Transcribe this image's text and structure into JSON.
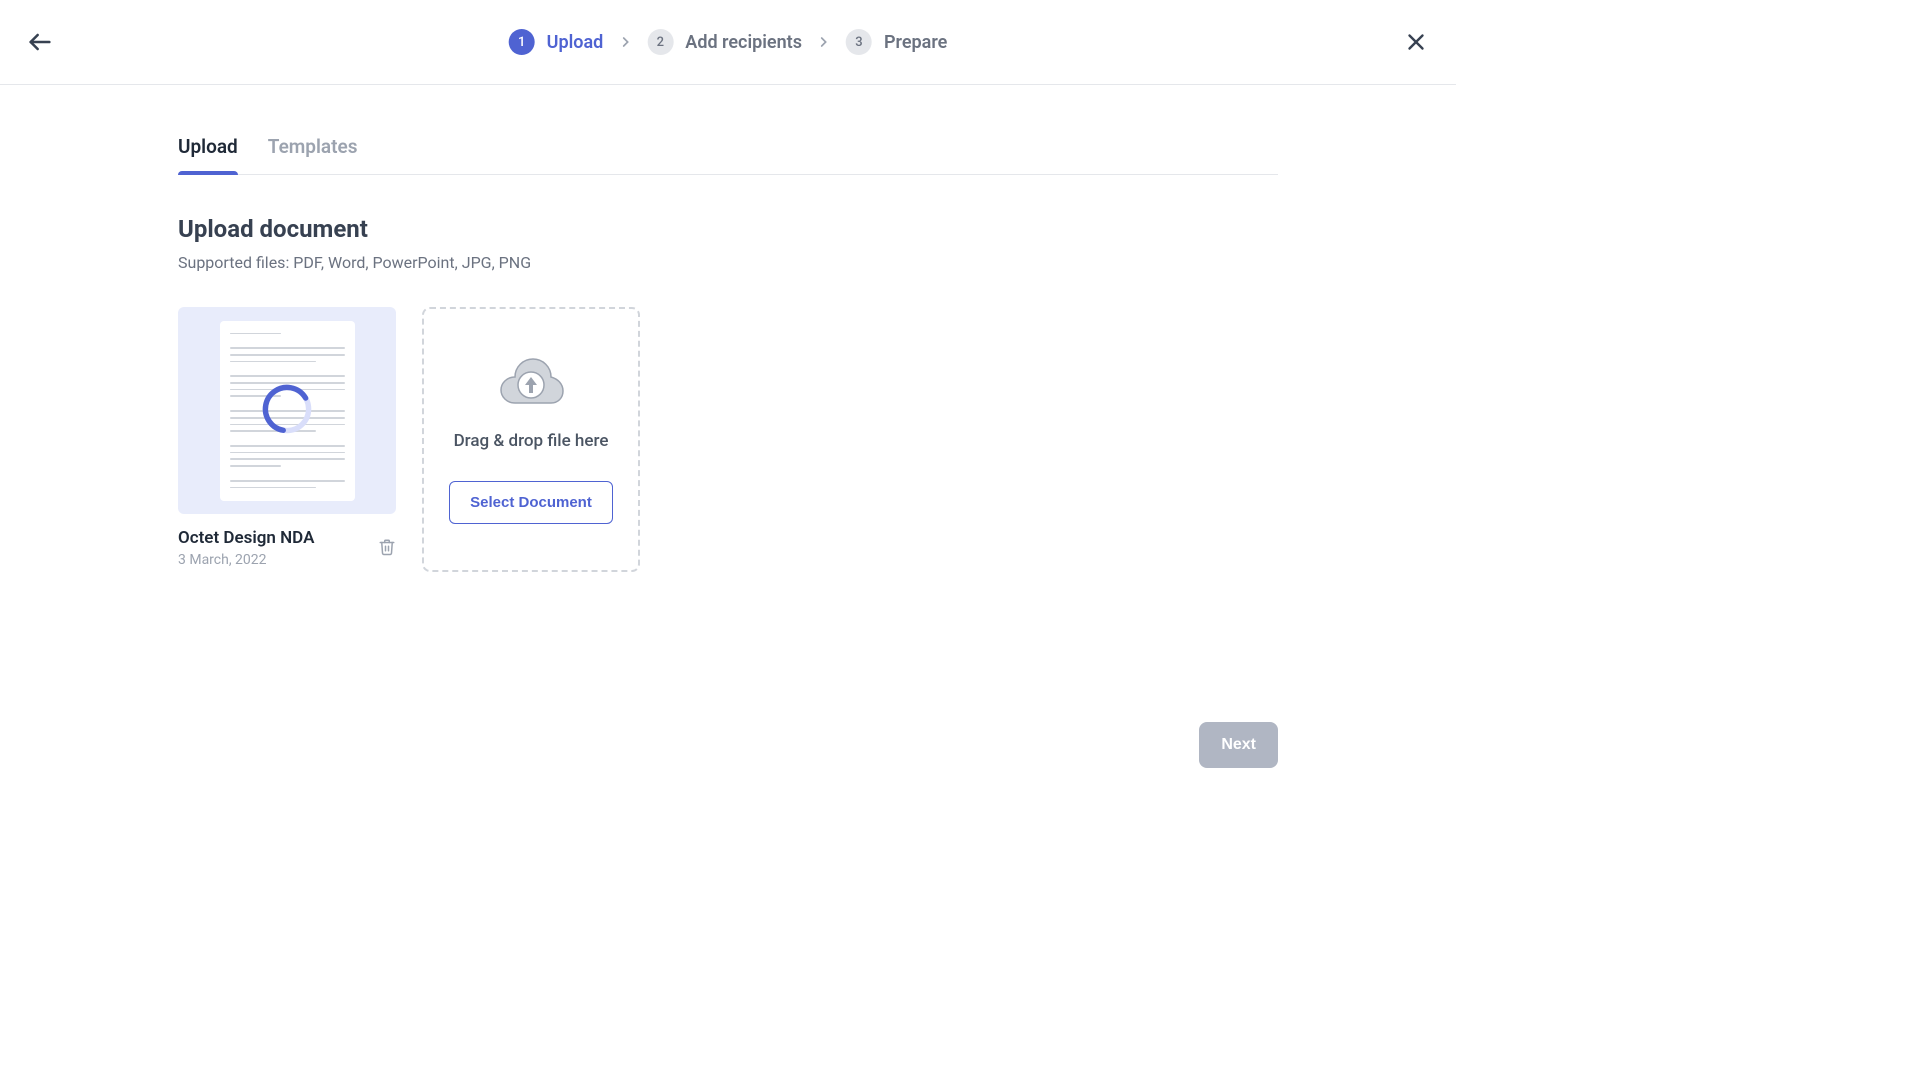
{
  "stepper": {
    "steps": [
      {
        "num": "1",
        "label": "Upload",
        "active": true
      },
      {
        "num": "2",
        "label": "Add recipients",
        "active": false
      },
      {
        "num": "3",
        "label": "Prepare",
        "active": false
      }
    ]
  },
  "tabs": {
    "upload": "Upload",
    "templates": "Templates"
  },
  "section": {
    "title": "Upload document",
    "subtitle": "Supported files: PDF, Word, PowerPoint, JPG, PNG"
  },
  "document": {
    "title": "Octet Design NDA",
    "date": "3 March, 2022"
  },
  "dropzone": {
    "text": "Drag & drop file here",
    "button": "Select Document"
  },
  "footer": {
    "next": "Next"
  }
}
